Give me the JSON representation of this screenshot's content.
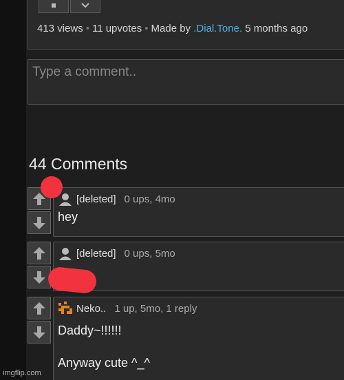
{
  "post": {
    "views": "413 views",
    "upvotes": "11 upvotes",
    "made_by_prefix": "Made by",
    "author": ".Dial.Tone.",
    "time": "5 months ago"
  },
  "comment_box": {
    "placeholder": "Type a comment.."
  },
  "comments_heading": "44 Comments",
  "comments": [
    {
      "user": "[deleted]",
      "info": "0 ups, 4mo",
      "text": "hey",
      "avatar": "default-user-icon"
    },
    {
      "user": "[deleted]",
      "info": "0 ups, 5mo",
      "text": "",
      "avatar": "default-user-icon"
    },
    {
      "user": "Neko..",
      "info": "1 up, 5mo, 1 reply",
      "text_line1": "Daddy~!!!!!!",
      "text_line2": "Anyway cute ^_^",
      "avatar": "pixel-avatar-icon"
    }
  ],
  "watermark": "imgflip.com",
  "colors": {
    "link": "#4ab2e8",
    "annotation_red": "#f2333f",
    "background": "#1e1e1e"
  }
}
